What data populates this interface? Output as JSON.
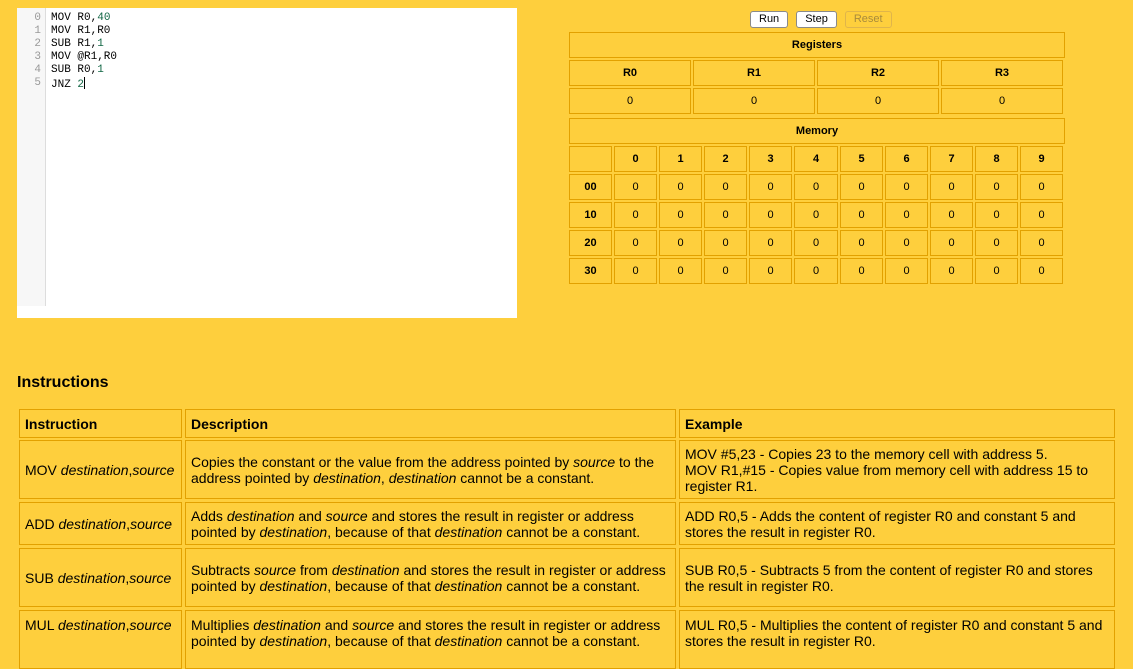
{
  "editor": {
    "lines": [
      {
        "num": "0",
        "op": "MOV ",
        "a": "R0,",
        "n": "40"
      },
      {
        "num": "1",
        "op": "MOV ",
        "a": "R1,R0",
        "n": ""
      },
      {
        "num": "2",
        "op": "SUB ",
        "a": "R1,",
        "n": "1"
      },
      {
        "num": "3",
        "op": "MOV ",
        "a": "@R1,R0",
        "n": ""
      },
      {
        "num": "4",
        "op": "SUB ",
        "a": "R0,",
        "n": "1"
      },
      {
        "num": "5",
        "op": "JNZ ",
        "a": "",
        "n": "2"
      }
    ]
  },
  "controls": {
    "run_label": "Run",
    "step_label": "Step",
    "reset_label": "Reset"
  },
  "registers": {
    "title": "Registers",
    "names": [
      "R0",
      "R1",
      "R2",
      "R3"
    ],
    "values": [
      "0",
      "0",
      "0",
      "0"
    ]
  },
  "memory": {
    "title": "Memory",
    "columns": [
      "0",
      "1",
      "2",
      "3",
      "4",
      "5",
      "6",
      "7",
      "8",
      "9"
    ],
    "rows": [
      {
        "label": "00",
        "values": [
          "0",
          "0",
          "0",
          "0",
          "0",
          "0",
          "0",
          "0",
          "0",
          "0"
        ]
      },
      {
        "label": "10",
        "values": [
          "0",
          "0",
          "0",
          "0",
          "0",
          "0",
          "0",
          "0",
          "0",
          "0"
        ]
      },
      {
        "label": "20",
        "values": [
          "0",
          "0",
          "0",
          "0",
          "0",
          "0",
          "0",
          "0",
          "0",
          "0"
        ]
      },
      {
        "label": "30",
        "values": [
          "0",
          "0",
          "0",
          "0",
          "0",
          "0",
          "0",
          "0",
          "0",
          "0"
        ]
      }
    ]
  },
  "instructions": {
    "title": "Instructions",
    "headers": {
      "instruction": "Instruction",
      "description": "Description",
      "example": "Example"
    },
    "rows": [
      {
        "instr": [
          {
            "t": "MOV "
          },
          {
            "t": "destination",
            "i": true
          },
          {
            "t": ","
          },
          {
            "t": "source",
            "i": true
          }
        ],
        "desc": [
          {
            "t": "Copies the constant or the value from the address pointed by "
          },
          {
            "t": "source",
            "i": true
          },
          {
            "t": " to the address pointed by "
          },
          {
            "t": "destination",
            "i": true
          },
          {
            "t": ", "
          },
          {
            "t": "destination",
            "i": true
          },
          {
            "t": " cannot be a constant."
          }
        ],
        "example": [
          {
            "t": "MOV #5,23 - Copies 23 to the memory cell with address 5."
          },
          {
            "br": true
          },
          {
            "t": "MOV R1,#15 - Copies value from memory cell with address 15 to register R1."
          }
        ]
      },
      {
        "instr": [
          {
            "t": "ADD "
          },
          {
            "t": "destination",
            "i": true
          },
          {
            "t": ","
          },
          {
            "t": "source",
            "i": true
          }
        ],
        "desc": [
          {
            "t": "Adds "
          },
          {
            "t": "destination",
            "i": true
          },
          {
            "t": " and "
          },
          {
            "t": "source",
            "i": true
          },
          {
            "t": " and stores the result in register or address pointed by "
          },
          {
            "t": "destination",
            "i": true
          },
          {
            "t": ", because of that "
          },
          {
            "t": "destination",
            "i": true
          },
          {
            "t": " cannot be a constant."
          }
        ],
        "example": [
          {
            "t": "ADD R0,5 - Adds the content of register R0 and constant 5 and stores the result in register R0."
          }
        ]
      },
      {
        "instr": [
          {
            "t": "SUB "
          },
          {
            "t": "destination",
            "i": true
          },
          {
            "t": ","
          },
          {
            "t": "source",
            "i": true
          }
        ],
        "desc": [
          {
            "t": "Subtracts "
          },
          {
            "t": "source",
            "i": true
          },
          {
            "t": " from "
          },
          {
            "t": "destination",
            "i": true
          },
          {
            "t": " and stores the result in register or address pointed by "
          },
          {
            "t": "destination",
            "i": true
          },
          {
            "t": ", because of that "
          },
          {
            "t": "destination",
            "i": true
          },
          {
            "t": " cannot be a constant."
          }
        ],
        "example": [
          {
            "t": "SUB R0,5 - Subtracts 5 from the content of register R0 and stores the result in register R0."
          }
        ]
      },
      {
        "instr": [
          {
            "t": "MUL "
          },
          {
            "t": "destination",
            "i": true
          },
          {
            "t": ","
          },
          {
            "t": "source",
            "i": true
          }
        ],
        "desc": [
          {
            "t": "Multiplies "
          },
          {
            "t": "destination",
            "i": true
          },
          {
            "t": " and "
          },
          {
            "t": "source",
            "i": true
          },
          {
            "t": " and stores the result in register or address pointed by "
          },
          {
            "t": "destination",
            "i": true
          },
          {
            "t": ", because of that "
          },
          {
            "t": "destination",
            "i": true
          },
          {
            "t": " cannot be a constant."
          }
        ],
        "example": [
          {
            "t": "MUL R0,5 - Multiplies the content of register R0 and constant 5 and stores the result in register R0."
          }
        ]
      }
    ]
  }
}
